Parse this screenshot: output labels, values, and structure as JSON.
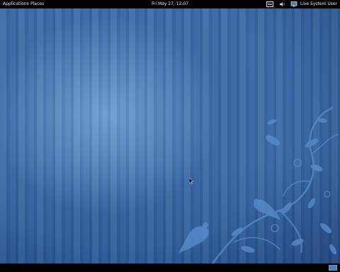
{
  "top_panel": {
    "applications_label": "Applications",
    "places_label": "Places",
    "clock": "Fri May 27, 12:07",
    "user_label": "Live System User",
    "tray_icons": [
      "keyboard-icon",
      "volume-icon",
      "network-icon"
    ]
  },
  "desktop": {
    "wallpaper_colors": {
      "base": "#3a69a6",
      "highlight": "#96c8f5",
      "art": "#5b8fcf"
    }
  },
  "bottom_panel": {
    "workspace_icon": "workspace-switcher-icon"
  }
}
